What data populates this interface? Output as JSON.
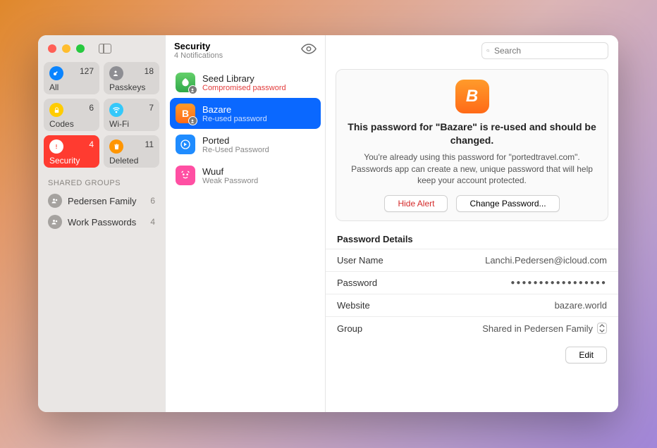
{
  "sidebar": {
    "categories": [
      {
        "id": "all",
        "label": "All",
        "count": "127"
      },
      {
        "id": "passkeys",
        "label": "Passkeys",
        "count": "18"
      },
      {
        "id": "codes",
        "label": "Codes",
        "count": "6"
      },
      {
        "id": "wifi",
        "label": "Wi-Fi",
        "count": "7"
      },
      {
        "id": "security",
        "label": "Security",
        "count": "4"
      },
      {
        "id": "deleted",
        "label": "Deleted",
        "count": "11"
      }
    ],
    "shared_label": "SHARED GROUPS",
    "groups": [
      {
        "name": "Pedersen Family",
        "count": "6"
      },
      {
        "name": "Work Passwords",
        "count": "4"
      }
    ]
  },
  "mid": {
    "title": "Security",
    "subtitle": "4 Notifications",
    "items": [
      {
        "name": "Seed Library",
        "reason": "Compromised password",
        "reason_red": true
      },
      {
        "name": "Bazare",
        "reason": "Re-used password"
      },
      {
        "name": "Ported",
        "reason": "Re-Used Password"
      },
      {
        "name": "Wuuf",
        "reason": "Weak Password"
      }
    ]
  },
  "search": {
    "placeholder": "Search"
  },
  "alert": {
    "heading": "This password for \"Bazare\" is re-used and should be changed.",
    "desc": "You're already using this password for \"portedtravel.com\". Passwords app can create a new, unique password that will help keep your account protected.",
    "hide_label": "Hide Alert",
    "change_label": "Change Password..."
  },
  "details": {
    "section_title": "Password Details",
    "username_label": "User Name",
    "username_value": "Lanchi.Pedersen@icloud.com",
    "password_label": "Password",
    "password_value": "●●●●●●●●●●●●●●●●●",
    "website_label": "Website",
    "website_value": "bazare.world",
    "group_label": "Group",
    "group_value": "Shared in Pedersen Family",
    "edit_label": "Edit"
  }
}
